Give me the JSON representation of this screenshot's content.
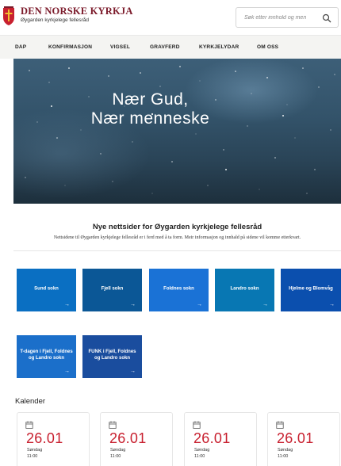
{
  "header": {
    "brand_title": "DEN NORSKE KYRKJA",
    "brand_subtitle": "Øygarden kyrkjelege fellesråd",
    "logo_icon": "church-shield-icon",
    "search": {
      "placeholder": "Søk etter innhold og men",
      "icon": "search-icon"
    }
  },
  "nav": {
    "items": [
      {
        "label": "DAP"
      },
      {
        "label": "KONFIRMASJON"
      },
      {
        "label": "VIGSEL"
      },
      {
        "label": "GRAVFERD"
      },
      {
        "label": "KYRKJELYDAR"
      },
      {
        "label": "OM OSS"
      }
    ]
  },
  "hero": {
    "line1": "Nær Gud,",
    "line2": "Nær menneske"
  },
  "intro": {
    "heading": "Nye nettsider for Øygarden kyrkjelege fellesråd",
    "text": "Nettsidene til Øygarden kyrkjelege fellesråd er i ferd med å ta form. Meir informasjon og innhald på sidene vil komme etterkvart."
  },
  "tiles": [
    {
      "label": "Sund sokn",
      "arrow": "→",
      "color": "#0a6fc2"
    },
    {
      "label": "Fjell sokn",
      "arrow": "→",
      "color": "#0b5796"
    },
    {
      "label": "Foldnes sokn",
      "arrow": "→",
      "color": "#1a72d6"
    },
    {
      "label": "Landro sokn",
      "arrow": "→",
      "color": "#0877b3"
    },
    {
      "label": "Hjelme og Blomvåg",
      "arrow": "→",
      "color": "#0b4fae"
    },
    {
      "label": "T-dagen i Fjell, Foldnes og Landro sokn",
      "arrow": "→",
      "color": "#1b6fca"
    },
    {
      "label": "FUNK i Fjell, Foldnes og Landro sokn",
      "arrow": "→",
      "color": "#1a4d9e"
    }
  ],
  "calendar": {
    "heading": "Kalender",
    "events": [
      {
        "date": "26.01",
        "day": "Søndag",
        "time": "11:00",
        "icon": "calendar-icon"
      },
      {
        "date": "26.01",
        "day": "Søndag",
        "time": "11:00",
        "icon": "calendar-icon"
      },
      {
        "date": "26.01",
        "day": "Søndag",
        "time": "11:00",
        "icon": "calendar-icon"
      },
      {
        "date": "26.01",
        "day": "Søndag",
        "time": "11:00",
        "icon": "calendar-icon"
      }
    ]
  },
  "colors": {
    "brand": "#7b1a2a",
    "accent_red": "#c8202f",
    "nav_bg": "#f4f4f2"
  }
}
